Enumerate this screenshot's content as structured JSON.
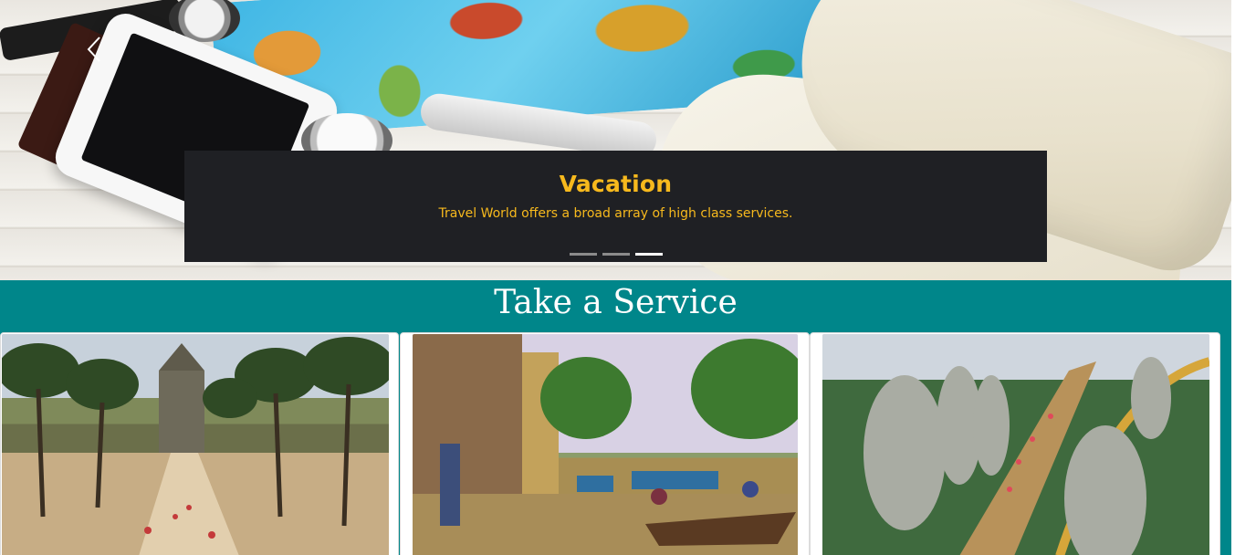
{
  "carousel": {
    "prev_icon": "chevron-left-icon",
    "caption_title": "Vacation",
    "caption_text": "Travel World offers a broad array of high class services.",
    "slide_count": 3,
    "active_index": 2,
    "caption_color": "#f7b91d"
  },
  "service": {
    "heading": "Take a Service",
    "background": "#00868a",
    "cards": [
      {
        "image": "temple-palm-trees-photo"
      },
      {
        "image": "flooded-street-boats-photo"
      },
      {
        "image": "golden-bridge-hands-photo"
      }
    ]
  }
}
